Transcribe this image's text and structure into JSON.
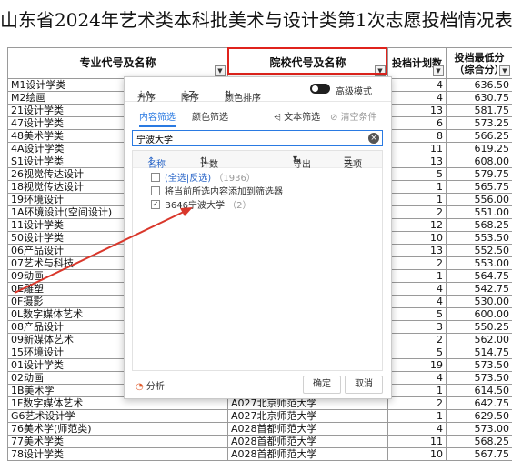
{
  "title": "山东省2024年艺术类本科批美术与设计类第1次志愿投档情况表",
  "headers": {
    "major": "专业代号及名称",
    "school": "院校代号及名称",
    "plan": "投档计划数",
    "min_score": "投档最低分（综合分）"
  },
  "rows": [
    {
      "major": "M1设计学类",
      "school": "",
      "plan": "4",
      "score": "636.50"
    },
    {
      "major": "M2绘画",
      "school": "",
      "plan": "4",
      "score": "630.75"
    },
    {
      "major": "21设计学类",
      "school": "",
      "plan": "13",
      "score": "581.75"
    },
    {
      "major": "47设计学类",
      "school": "",
      "plan": "6",
      "score": "573.25"
    },
    {
      "major": "48美术学类",
      "school": "",
      "plan": "8",
      "score": "566.25"
    },
    {
      "major": "4A设计学类",
      "school": "",
      "plan": "11",
      "score": "619.25"
    },
    {
      "major": "S1设计学类",
      "school": "",
      "plan": "13",
      "score": "608.00"
    },
    {
      "major": "26视觉传达设计",
      "school": "",
      "plan": "5",
      "score": "579.75"
    },
    {
      "major": "18视觉传达设计",
      "school": "",
      "plan": "1",
      "score": "565.75"
    },
    {
      "major": "19环境设计",
      "school": "",
      "plan": "1",
      "score": "556.00"
    },
    {
      "major": "1A环境设计(空间设计)",
      "school": "",
      "plan": "2",
      "score": "551.00"
    },
    {
      "major": "11设计学类",
      "school": "",
      "plan": "12",
      "score": "568.25"
    },
    {
      "major": "50设计学类",
      "school": "",
      "plan": "10",
      "score": "553.50"
    },
    {
      "major": "06产品设计",
      "school": "",
      "plan": "13",
      "score": "552.50"
    },
    {
      "major": "07艺术与科技",
      "school": "",
      "plan": "2",
      "score": "553.00"
    },
    {
      "major": "09动画",
      "school": "",
      "plan": "1",
      "score": "564.75"
    },
    {
      "major": "0E雕塑",
      "school": "",
      "plan": "4",
      "score": "542.75"
    },
    {
      "major": "0F摄影",
      "school": "",
      "plan": "4",
      "score": "530.00"
    },
    {
      "major": "0L数字媒体艺术",
      "school": "",
      "plan": "5",
      "score": "600.00"
    },
    {
      "major": "08产品设计",
      "school": "",
      "plan": "3",
      "score": "550.25"
    },
    {
      "major": "09新媒体艺术",
      "school": "",
      "plan": "2",
      "score": "562.00"
    },
    {
      "major": "15环境设计",
      "school": "",
      "plan": "5",
      "score": "514.75"
    },
    {
      "major": "01设计学类",
      "school": "",
      "plan": "19",
      "score": "573.50"
    },
    {
      "major": "02动画",
      "school": "",
      "plan": "4",
      "score": "573.50"
    },
    {
      "major": "1B美术学",
      "school": "",
      "plan": "1",
      "score": "614.50"
    },
    {
      "major": "1F数字媒体艺术",
      "school": "A027北京师范大学",
      "plan": "2",
      "score": "642.75"
    },
    {
      "major": "G6艺术设计学",
      "school": "A027北京师范大学",
      "plan": "1",
      "score": "629.50"
    },
    {
      "major": "76美术学(师范类)",
      "school": "A028首都师范大学",
      "plan": "4",
      "score": "573.00"
    },
    {
      "major": "77美术学类",
      "school": "A028首都师范大学",
      "plan": "11",
      "score": "568.25"
    },
    {
      "major": "78设计学类",
      "school": "A028首都师范大学",
      "plan": "10",
      "score": "567.75"
    }
  ],
  "filter_panel": {
    "sort_asc": "升序",
    "sort_desc": "降序",
    "color_sort": "颜色排序",
    "advanced_mode": "高级模式",
    "tab_content": "内容筛选",
    "tab_color": "颜色筛选",
    "text_filter": "文本筛选",
    "clear_condition": "清空条件",
    "search_value": "宁波大学",
    "col_name": "名称",
    "col_count": "计数",
    "export": "导出",
    "options": "选项",
    "items": [
      {
        "label": "(全选|反选)",
        "count": "（1936）",
        "checked": false
      },
      {
        "label": "将当前所选内容添加到筛选器",
        "count": "",
        "checked": false
      },
      {
        "label": "B646宁波大学",
        "count": "（2）",
        "checked": true
      }
    ],
    "analyze": "分析",
    "ok": "确定",
    "cancel": "取消"
  },
  "colors": {
    "accent": "#2a7ae2",
    "highlight_box": "#e0231c",
    "arrow": "#d9372b"
  }
}
